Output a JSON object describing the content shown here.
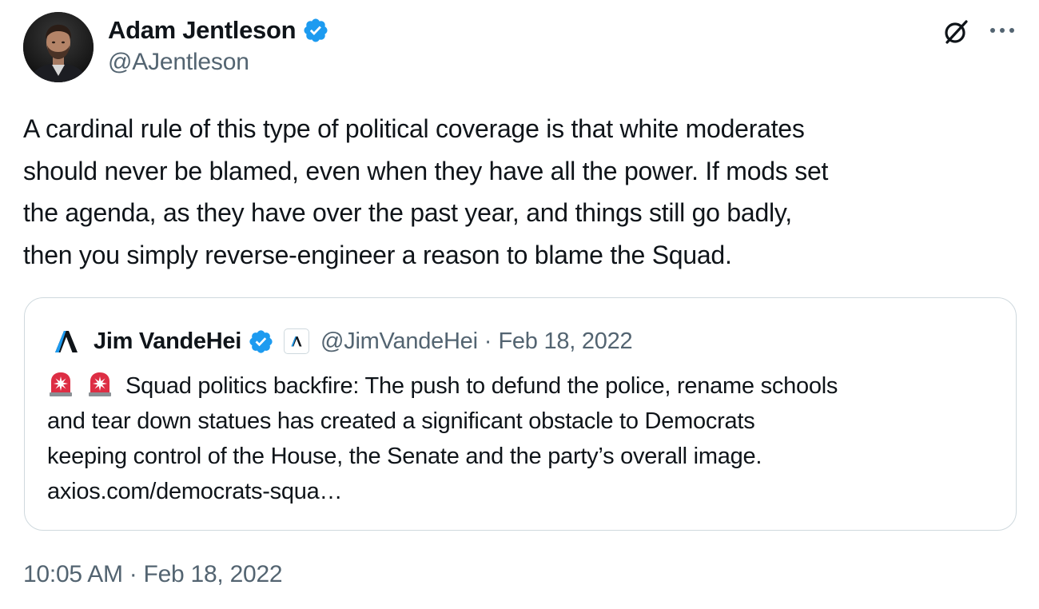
{
  "author": {
    "name": "Adam Jentleson",
    "handle": "@AJentleson",
    "verified": true,
    "avatar": "avatar-photo"
  },
  "header_actions": {
    "grok_icon": "grok-icon",
    "more_icon": "more-icon"
  },
  "tweet": {
    "text_lines": [
      "A cardinal rule of this type of political coverage is that white moderates",
      "should never be blamed, even when they have all the power. If mods set",
      "the agenda, as they have over the past year, and things still go badly,",
      "then you simply reverse-engineer a reason to blame the Squad."
    ]
  },
  "quoted_tweet": {
    "author_name": "Jim VandeHei",
    "handle": "@JimVandeHei",
    "separator": "·",
    "date": "Feb 18, 2022",
    "logo_icon": "axios-logo-icon",
    "affiliation_icon": "axios-affiliation-badge-icon",
    "emoji_icons": [
      "siren-emoji-icon",
      "siren-emoji-icon"
    ],
    "text_lines": [
      "Squad politics backfire: The push to defund the police, rename schools",
      "and tear down statues has created a significant obstacle to Democrats",
      "keeping control of the House, the Senate and the party’s overall image."
    ],
    "link_text": "axios.com/democrats-squa…"
  },
  "footer": {
    "time": "10:05 AM",
    "separator": "·",
    "date": "Feb 18, 2022"
  },
  "colors": {
    "text_primary": "#0f1419",
    "text_secondary": "#536471",
    "border": "#cfd9de",
    "verified_blue": "#1d9bf0"
  }
}
